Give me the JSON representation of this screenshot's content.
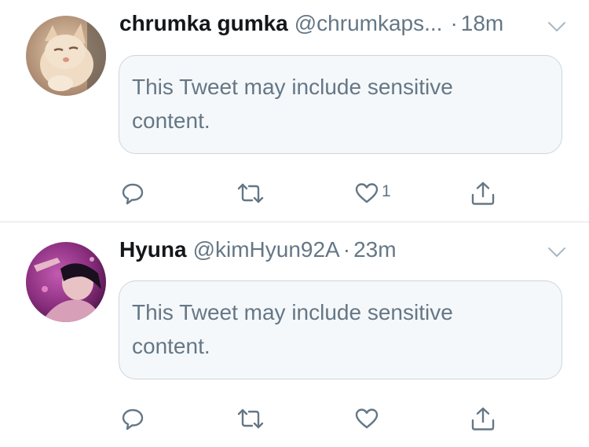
{
  "tweets": [
    {
      "display_name": "chrumka gumka",
      "handle": "@chrumkaps...",
      "separator": "·",
      "time": "18m",
      "notice": "This Tweet may include sensitive content.",
      "like_count": "1",
      "avatar": "cat-photo"
    },
    {
      "display_name": "Hyuna",
      "handle": "@kimHyun92A",
      "separator": "·",
      "time": "23m",
      "notice": "This Tweet may include sensitive content.",
      "like_count": "",
      "avatar": "person-photo"
    }
  ],
  "icons": {
    "reply": "reply-icon",
    "retweet": "retweet-icon",
    "like": "heart-icon",
    "share": "share-icon",
    "menu": "chevron-down-icon"
  },
  "colors": {
    "text_primary": "#14171a",
    "text_secondary": "#657786",
    "box_background": "#f5f8fa",
    "box_border": "#ccd6dd",
    "divider": "#dfe3e8"
  }
}
